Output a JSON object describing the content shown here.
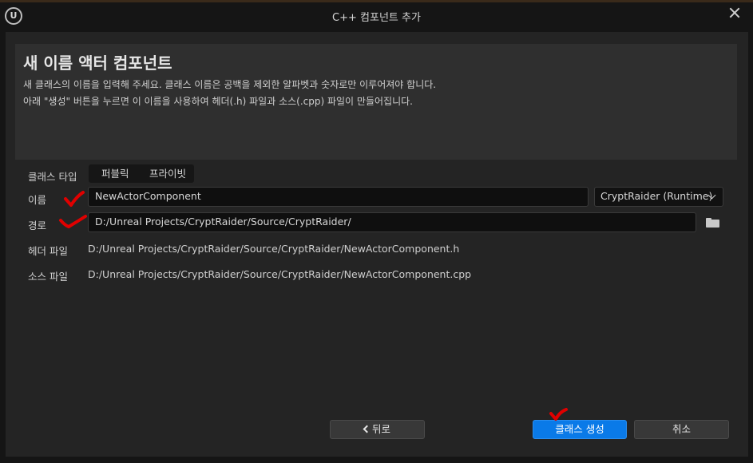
{
  "window": {
    "title": "C++ 컴포넌트 추가"
  },
  "header": {
    "heading": "새 이름 액터 컴포넌트",
    "description_line1": "새 클래스의 이름을 입력해 주세요. 클래스 이름은 공백을 제외한 알파벳과 숫자로만 이루어져야 합니다.",
    "description_line2": "아래 \"생성\" 버튼을 누르면 이 이름을 사용하여 헤더(.h) 파일과 소스(.cpp) 파일이 만들어집니다."
  },
  "form": {
    "class_type_label": "클래스 타입",
    "class_type_options": [
      "퍼블릭",
      "프라이빗"
    ],
    "name_label": "이름",
    "name_value": "NewActorComponent",
    "module_selected": "CryptRaider (Runtime)",
    "path_label": "경로",
    "path_value": "D:/Unreal Projects/CryptRaider/Source/CryptRaider/",
    "header_label": "헤더 파일",
    "header_value": "D:/Unreal Projects/CryptRaider/Source/CryptRaider/NewActorComponent.h",
    "source_label": "소스 파일",
    "source_value": "D:/Unreal Projects/CryptRaider/Source/CryptRaider/NewActorComponent.cpp"
  },
  "footer": {
    "back_label": "뒤로",
    "create_label": "클래스 생성",
    "cancel_label": "취소"
  },
  "icons": {
    "logo": "unreal-logo-icon",
    "close": "close-icon",
    "folder": "folder-icon",
    "chevron": "chevron-down-icon",
    "back": "chevron-left-icon"
  },
  "colors": {
    "accent": "#0a7ae8",
    "annotation": "#e00000"
  }
}
